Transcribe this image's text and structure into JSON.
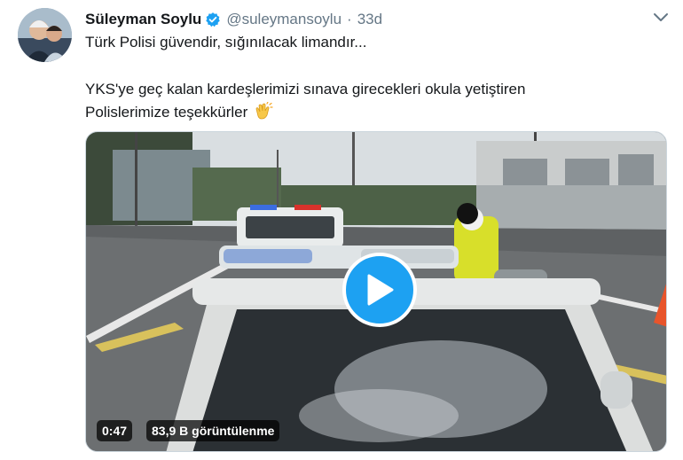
{
  "tweet": {
    "author_name": "Süleyman Soylu",
    "handle": "@suleymansoylu",
    "separator": "·",
    "time": "33d",
    "line1": "Türk Polisi güvendir, sığınılacak limandır...",
    "line2": "YKS'ye geç kalan kardeşlerimizi sınava girecekleri okula yetiştiren",
    "line3": "Polislerimize teşekkürler"
  },
  "video": {
    "duration": "0:47",
    "views": "83,9 B görüntülenme"
  },
  "colors": {
    "accent": "#1da1f2",
    "text": "#14171a",
    "secondary": "#657786"
  },
  "icons": {
    "verified": "verified-badge-icon",
    "menu": "chevron-down-icon",
    "emoji": "clapping-hands-icon",
    "play": "play-icon"
  }
}
